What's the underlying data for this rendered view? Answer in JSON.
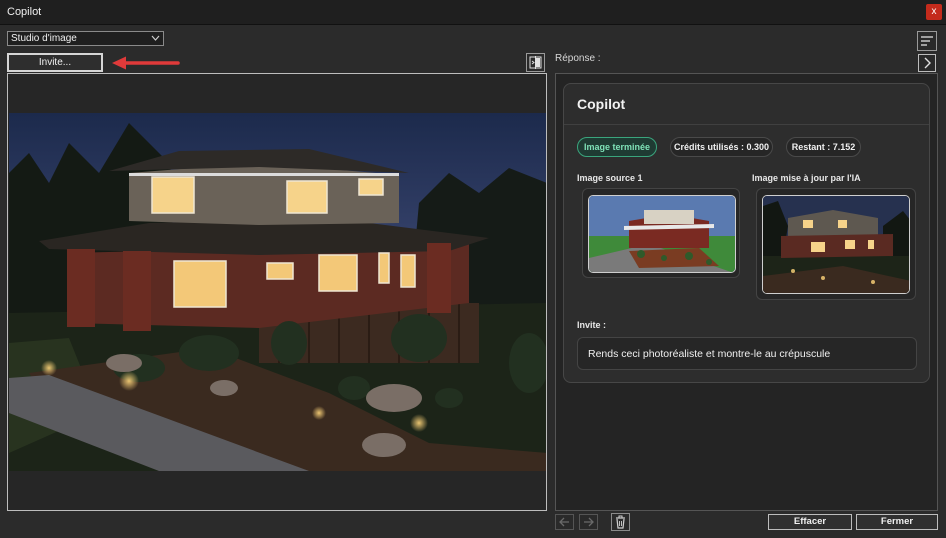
{
  "window": {
    "title": "Copilot",
    "close_glyph": "x"
  },
  "toolbar": {
    "mode_select": {
      "value": "Studio d'image"
    },
    "invite_button": "Invite...",
    "icons": {
      "compare": "compare-icon",
      "menu": "menu-icon",
      "collapse": "chevron-right-icon",
      "arrow": "red-arrow-icon"
    }
  },
  "right": {
    "reponse_label": "Réponse :",
    "card": {
      "title": "Copilot",
      "status": "Image terminée",
      "credits": "Crédits utilisés : 0.300",
      "remaining": "Restant : 7.152",
      "source_label": "Image source 1",
      "updated_label": "Image mise à jour par l'IA",
      "prompt_label": "Invite :",
      "prompt_text": "Rends ceci photoréaliste et montre-le au crépuscule"
    }
  },
  "footer": {
    "clear": "Effacer",
    "close": "Fermer"
  },
  "colors": {
    "accent_green": "#3aa57d",
    "arrow_red": "#e03a3a",
    "close_red": "#c42b1c"
  }
}
